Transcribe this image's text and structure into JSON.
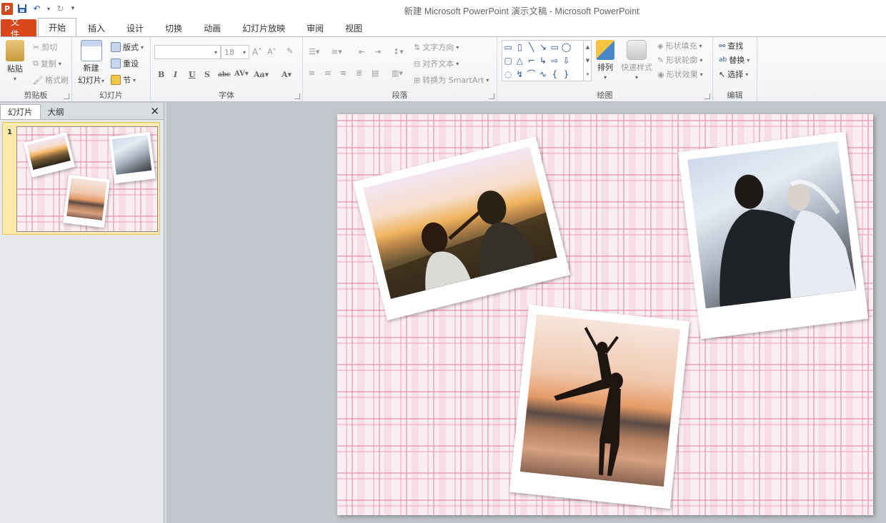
{
  "titlebar": {
    "title": "新建 Microsoft PowerPoint 演示文稿 - Microsoft PowerPoint",
    "app_logo": "P"
  },
  "tabs": [
    "文件",
    "开始",
    "插入",
    "设计",
    "切换",
    "动画",
    "幻灯片放映",
    "审阅",
    "视图"
  ],
  "ribbon": {
    "clipboard": {
      "paste": "粘贴",
      "cut": "剪切",
      "copy": "复制",
      "format_painter": "格式刷",
      "label": "剪贴板"
    },
    "slides": {
      "new_slide_1": "新建",
      "new_slide_2": "幻灯片",
      "layout": "版式",
      "reset": "重设",
      "section": "节",
      "label": "幻灯片"
    },
    "font": {
      "font_name": "",
      "font_size": "18",
      "label": "字体"
    },
    "paragraph": {
      "text_direction": "文字方向",
      "align_text": "对齐文本",
      "smartart": "转换为 SmartArt",
      "label": "段落"
    },
    "drawing": {
      "arrange": "排列",
      "quick_styles": "快速样式",
      "shape_fill": "形状填充",
      "shape_outline": "形状轮廓",
      "shape_effects": "形状效果",
      "label": "绘图"
    },
    "editing": {
      "find": "查找",
      "replace": "替换",
      "select": "选择",
      "label": "编辑"
    }
  },
  "left_pane": {
    "tabs": [
      "幻灯片",
      "大纲"
    ],
    "slide_number": "1"
  },
  "colors": {
    "file_tab": "#d9461c",
    "plaid_pink": "#e288a0",
    "selection": "#fde9a8"
  }
}
